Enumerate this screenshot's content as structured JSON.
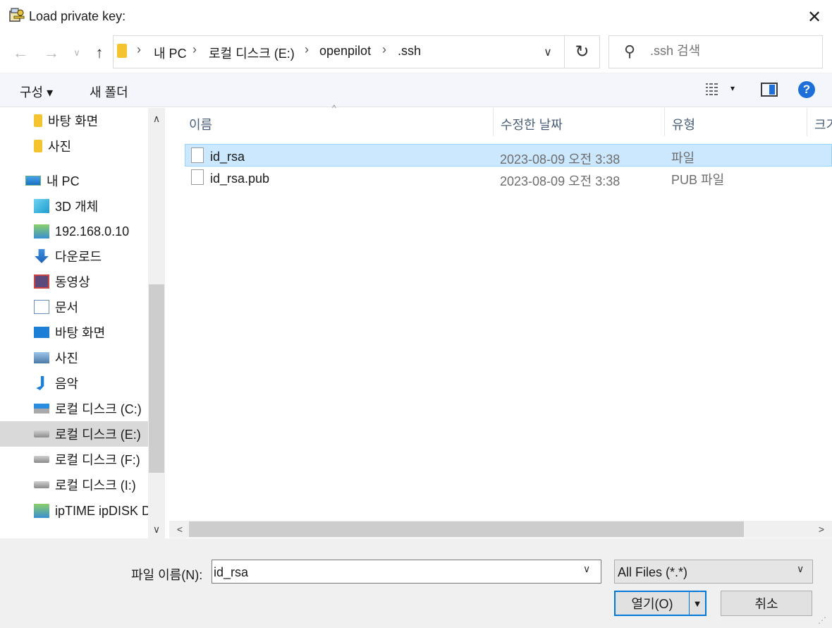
{
  "window": {
    "title": "Load private key:",
    "close_glyph": "✕"
  },
  "nav": {
    "back_glyph": "←",
    "forward_glyph": "→",
    "recent_glyph": "∨",
    "up_glyph": "↑",
    "breadcrumb": [
      "내 PC",
      "로컬 디스크 (E:)",
      "openpilot",
      ".ssh"
    ],
    "breadcrumb_sep": "›",
    "dropdown_glyph": "∨",
    "refresh_glyph": "↻"
  },
  "search": {
    "placeholder": ".ssh 검색",
    "icon_glyph": "⚲"
  },
  "toolbar": {
    "organize_label": "구성 ▾",
    "new_folder_label": "새 폴더",
    "view_drop_glyph": "▾",
    "help_glyph": "?"
  },
  "sidebar": {
    "items": [
      {
        "label": "바탕 화면",
        "icon": "folder-icon"
      },
      {
        "label": "사진",
        "icon": "folder-icon"
      },
      {
        "label": "내 PC",
        "icon": "computer-icon"
      },
      {
        "label": "3D 개체",
        "icon": "cube-icon"
      },
      {
        "label": "192.168.0.10",
        "icon": "network-drive-icon"
      },
      {
        "label": "다운로드",
        "icon": "download-icon"
      },
      {
        "label": "동영상",
        "icon": "video-icon"
      },
      {
        "label": "문서",
        "icon": "document-icon"
      },
      {
        "label": "바탕 화면",
        "icon": "desktop-icon"
      },
      {
        "label": "사진",
        "icon": "pictures-icon"
      },
      {
        "label": "음악",
        "icon": "music-icon"
      },
      {
        "label": "로컬 디스크 (C:)",
        "icon": "windows-drive-icon"
      },
      {
        "label": "로컬 디스크 (E:)",
        "icon": "drive-icon",
        "selected": true
      },
      {
        "label": "로컬 디스크 (F:)",
        "icon": "drive-icon"
      },
      {
        "label": "로컬 디스크 (I:)",
        "icon": "drive-icon"
      },
      {
        "label": "ipTIME ipDISK D",
        "icon": "network-drive-icon"
      }
    ],
    "scroll_up_glyph": "∧",
    "scroll_down_glyph": "∨"
  },
  "filelist": {
    "columns": [
      "이름",
      "수정한 날짜",
      "유형",
      "크기"
    ],
    "sort_glyph": "^",
    "rows": [
      {
        "name": "id_rsa",
        "date": "2023-08-09 오전 3:38",
        "type": "파일",
        "selected": true
      },
      {
        "name": "id_rsa.pub",
        "date": "2023-08-09 오전 3:38",
        "type": "PUB 파일",
        "selected": false
      }
    ],
    "hscroll_left_glyph": "<",
    "hscroll_right_glyph": ">"
  },
  "footer": {
    "filename_label": "파일 이름(N):",
    "filename_value": "id_rsa",
    "filter_value": "All Files (*.*)",
    "dropdown_glyph": "∨",
    "open_label": "열기(O)",
    "open_drop_glyph": "▼",
    "cancel_label": "취소",
    "grip_glyph": "⋰"
  },
  "colors": {
    "selection": "#cce8ff",
    "accent": "#0078d7",
    "help": "#1e6fd9"
  }
}
